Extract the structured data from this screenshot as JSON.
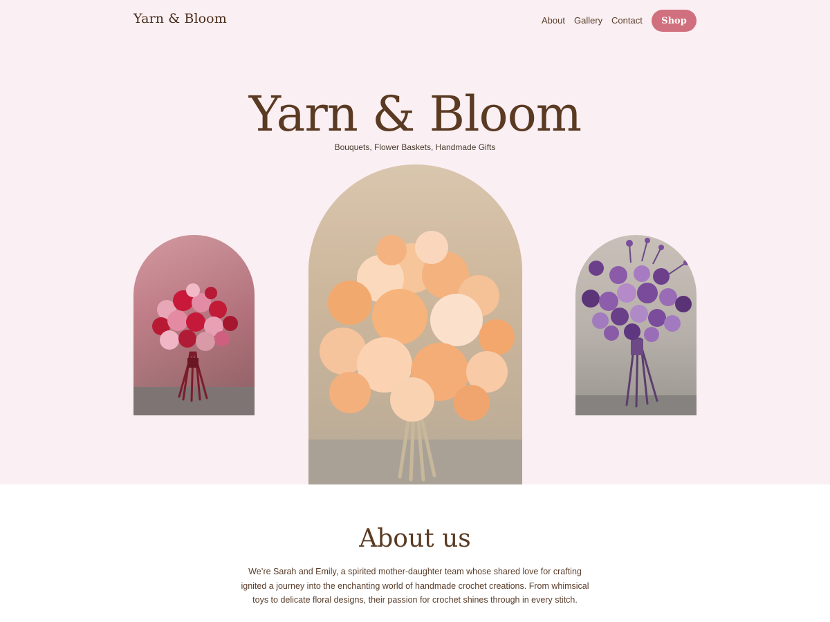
{
  "header": {
    "brand": "Yarn & Bloom",
    "nav": [
      "About",
      "Gallery",
      "Contact"
    ],
    "shop_label": "Shop"
  },
  "hero": {
    "title": "Yarn & Bloom",
    "subtitle": "Bouquets, Flower Baskets, Handmade Gifts",
    "images": [
      {
        "name": "red-pink-crochet-bouquet"
      },
      {
        "name": "peach-crochet-bouquet"
      },
      {
        "name": "purple-crochet-bouquet"
      }
    ]
  },
  "about": {
    "title": "About us",
    "text": "We’re Sarah and Emily, a spirited mother-daughter team whose shared love for crafting ignited a journey into the enchanting world of handmade crochet creations. From whimsical toys to delicate floral designs, their passion for crochet shines through in every stitch."
  },
  "colors": {
    "background_pink": "#faeff2",
    "accent": "#d0707e",
    "text_brown": "#5a3a22"
  }
}
